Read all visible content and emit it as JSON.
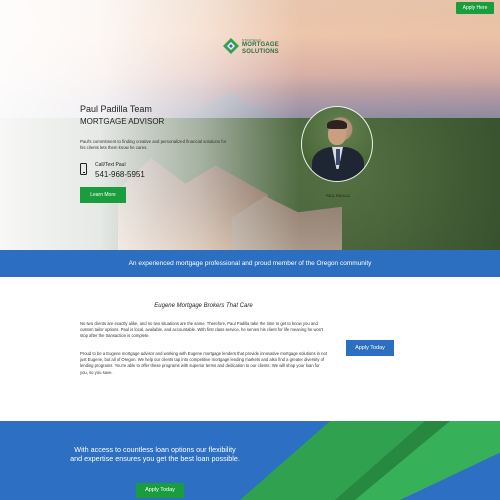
{
  "header": {
    "apply_label": "Apply Here"
  },
  "logo": {
    "line1": "STRATEGIC",
    "line2": "MORTGAGE",
    "line3": "SOLUTIONS"
  },
  "hero": {
    "team_name": "Paul Padilla Team",
    "role": "MORTGAGE ADVISOR",
    "description": "Paul's commitment to finding creative and personalized financial solutions for his clients lets them know he cares.",
    "call_label": "Call/Text Paul",
    "phone": "541-968-5951",
    "learn_more_label": "Learn More",
    "avatar_caption": "PAUL PADILLA"
  },
  "banner": {
    "text": "An experienced mortgage professional and proud member of the Oregon community"
  },
  "about": {
    "title": "Eugene Mortgage Brokers That Care",
    "para1": "No two clients are exactly alike, and no two situations are the same. Therefore, Paul Padilla take the time to get to know you and custom tailor options. Paul is local, available, and accountable. With first class service, he serves his client for life meaning he won't stop after the transaction is complete.",
    "para2": "Proud to be a Eugene mortgage advisor and working with Eugene mortgage lenders that provide innovative mortgage solutions in not just Eugene, but all of Oregon. We help our clients tap into competitive mortgage lending markets and also find a greater diversity of lending programs. You're able to offer these programs with superior terms and dedication to our clients. We will shop your loan for you, so you save.",
    "apply_label": "Apply Today"
  },
  "footer_cta": {
    "text": "With access to countless loan options our flexibility and expertise ensures you get the best loan possible.",
    "apply_label": "Apply Today"
  },
  "colors": {
    "green": "#1a9e3d",
    "blue": "#2c6fc1"
  }
}
